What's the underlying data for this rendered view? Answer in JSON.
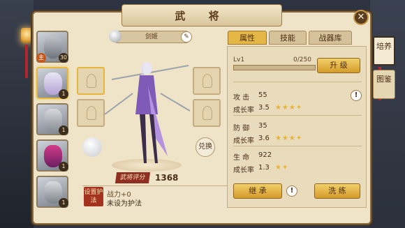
{
  "title": "武 将",
  "close_icon": "close-icon",
  "hero_list": [
    {
      "level": "30",
      "main_badge": "主",
      "selected": false
    },
    {
      "level": "1",
      "selected": true
    },
    {
      "level": "1",
      "selected": false
    },
    {
      "level": "1",
      "selected": false
    },
    {
      "level": "1",
      "selected": false
    }
  ],
  "hero_name": "剑姬",
  "rename_icon": "pencil-icon",
  "swap_label": "兑换",
  "rating": {
    "label": "武将评分",
    "value": "1368"
  },
  "guard": {
    "button": "设置护法",
    "power": "战力+0",
    "status": "未设为护法"
  },
  "tabs": [
    "属性",
    "技能",
    "战器库"
  ],
  "active_tab": 0,
  "stats": {
    "level": "Lv1",
    "exp": "0/250",
    "exp_progress": 0,
    "upgrade": "升 级",
    "attack": {
      "name": "攻 击",
      "value": "55",
      "growth_label": "成长率",
      "growth": "3.5",
      "stars": 3.5
    },
    "defense": {
      "name": "防 御",
      "value": "35",
      "growth_label": "成长率",
      "growth": "3.6",
      "stars": 3.5
    },
    "hp": {
      "name": "生 命",
      "value": "922",
      "growth_label": "成长率",
      "growth": "1.3",
      "stars": 1.5
    }
  },
  "inherit": "继 承",
  "refine": "洗 练",
  "side_tabs": [
    {
      "label": "培养",
      "active": true
    },
    {
      "label": "图鉴",
      "active": false
    }
  ],
  "colors": {
    "accent": "#e5b747",
    "panel": "#efe3c8",
    "dark": "#4a2d12",
    "red": "#a3321f"
  }
}
